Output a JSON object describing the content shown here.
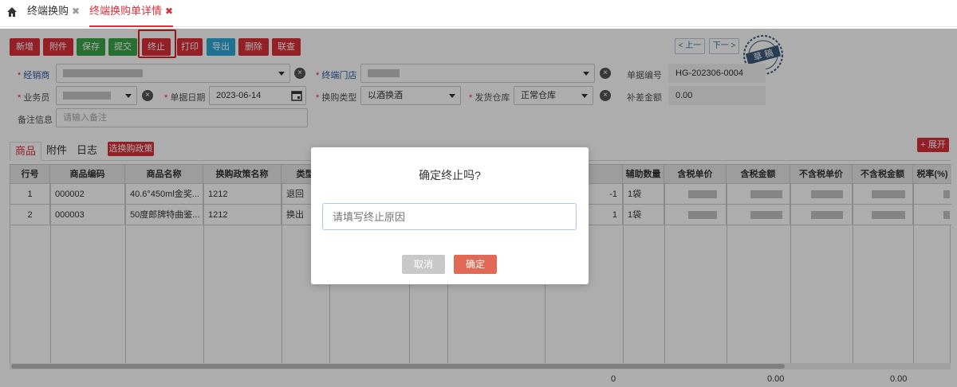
{
  "tabs": [
    {
      "label": "终端换购",
      "close": "✖"
    },
    {
      "label": "终端换购单详情",
      "close": "✖"
    }
  ],
  "toolbar": {
    "new": "新增",
    "attach": "附件",
    "save": "保存",
    "submit": "提交",
    "terminate": "终止",
    "print": "打印",
    "export": "导出",
    "delete": "删除",
    "query": "联查",
    "prev": "< 上一",
    "next": "下一 >"
  },
  "stamp": {
    "text": "草 稿"
  },
  "form": {
    "dealer_label": "经销商",
    "store_label": "终端门店",
    "doc_no_label": "单据编号",
    "doc_no": "HG-202306-0004",
    "salesman_label": "业务员",
    "date_label": "单据日期",
    "date": "2023-06-14",
    "exchange_type_label": "换购类型",
    "exchange_type": "以酒换酒",
    "warehouse_label": "发货仓库",
    "warehouse": "正常仓库",
    "diff_label": "补差金额",
    "diff": "0.00",
    "remark_label": "备注信息",
    "remark_placeholder": "请输入备注"
  },
  "subtabs": {
    "goods": "商品",
    "attach": "附件",
    "log": "日志",
    "policy_button": "选换购政策",
    "expand_button": "+ 展开"
  },
  "grid": {
    "headers": [
      "行号",
      "商品编码",
      "商品名称",
      "换购政策名称",
      "类型",
      "辅助数量",
      "含税单价",
      "含税金额",
      "不含税单价",
      "不含税金额",
      "税率(%)"
    ],
    "rows": [
      {
        "no": "1",
        "code": "000002",
        "name": "40.6°450ml金奖...",
        "policy": "1212",
        "type": "退回",
        "qty": "-1",
        "aux": "1袋"
      },
      {
        "no": "2",
        "code": "000003",
        "name": "50度郎牌特曲鉴...",
        "policy": "1212",
        "type": "换出",
        "qty": "1",
        "aux": "1袋"
      }
    ],
    "totals": {
      "qty": "0",
      "tax_amount": "0.00",
      "notax_amount": "0.00"
    }
  },
  "dialog": {
    "title": "确定终止吗?",
    "placeholder": "请填写终止原因",
    "cancel": "取消",
    "ok": "确定"
  }
}
